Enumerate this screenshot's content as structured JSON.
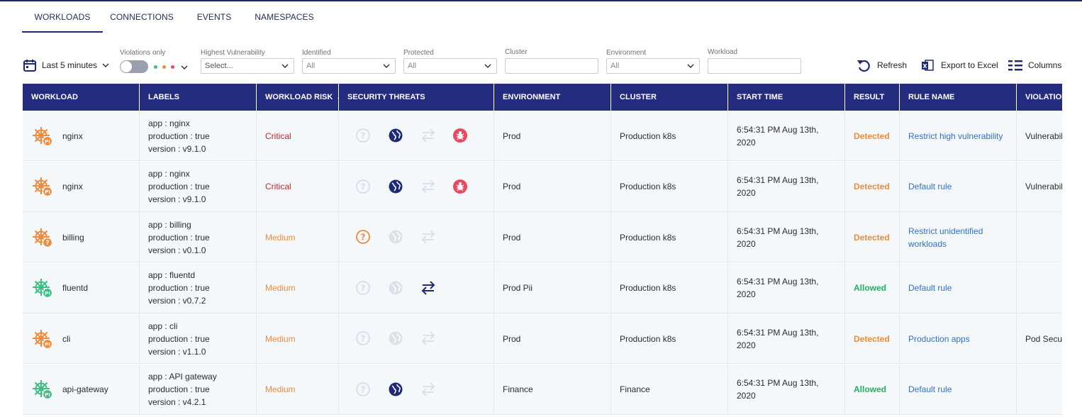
{
  "tabs": [
    "WORKLOADS",
    "CONNECTIONS",
    "EVENTS",
    "NAMESPACES"
  ],
  "filters": {
    "time": "Last 5 minutes",
    "violations_label": "Violations only",
    "vuln_label": "Highest Vulnerability",
    "vuln_placeholder": "Select...",
    "identified_label": "Identified",
    "identified_value": "All",
    "protected_label": "Protected",
    "protected_value": "All",
    "cluster_label": "Cluster",
    "environment_label": "Environment",
    "environment_value": "All",
    "workload_label": "Workload"
  },
  "actions": {
    "refresh": "Refresh",
    "export": "Export to Excel",
    "columns": "Columns"
  },
  "columns": [
    "WORKLOAD",
    "LABELS",
    "WORKLOAD RISK",
    "SECURITY THREATS",
    "ENVIRONMENT",
    "CLUSTER",
    "START TIME",
    "RESULT",
    "RULE NAME",
    "VIOLATION TYPE"
  ],
  "colors": {
    "header": "#232c7e",
    "accent": "#1e2a78",
    "orange": "#f08a3c",
    "green": "#3dbf83",
    "red": "#e84a5f",
    "link": "#2f6fce"
  },
  "rows": [
    {
      "name": "nginx",
      "icon": "helm-orange",
      "badge": "PI",
      "labels": [
        "app : nginx",
        "production : true",
        "version : v9.1.0"
      ],
      "risk": "Critical",
      "threats": {
        "unidentified": false,
        "network": true,
        "lateral": false,
        "malware": true
      },
      "environment": "Prod",
      "cluster": "Production k8s",
      "start_time_1": "6:54:31 PM Aug 13th,",
      "start_time_2": "2020",
      "result": "Detected",
      "rule": "Restrict high vulnerability",
      "violation": "Vulnerability"
    },
    {
      "name": "nginx",
      "icon": "helm-orange",
      "badge": "PI",
      "labels": [
        "app : nginx",
        "production : true",
        "version : v9.1.0"
      ],
      "risk": "Critical",
      "threats": {
        "unidentified": false,
        "network": true,
        "lateral": false,
        "malware": true
      },
      "environment": "Prod",
      "cluster": "Production k8s",
      "start_time_1": "6:54:31 PM Aug 13th,",
      "start_time_2": "2020",
      "result": "Detected",
      "rule": "Default rule",
      "violation": "Vulnerability"
    },
    {
      "name": "billing",
      "icon": "helm-orange",
      "badge": "?",
      "labels": [
        "app : billing",
        "production : true",
        "version : v0.1.0"
      ],
      "risk": "Medium",
      "threats": {
        "unidentified": true,
        "network": false,
        "lateral": false,
        "malware": null
      },
      "environment": "Prod",
      "cluster": "Production k8s",
      "start_time_1": "6:54:31 PM Aug 13th,",
      "start_time_2": "2020",
      "result": "Detected",
      "rule": "Restrict unidentified workloads",
      "violation": ""
    },
    {
      "name": "fluentd",
      "icon": "helm-green",
      "badge": "PI",
      "labels": [
        "app : fluentd",
        "production : true",
        "version : v0.7.2"
      ],
      "risk": "Medium",
      "threats": {
        "unidentified": false,
        "network": false,
        "lateral": true,
        "malware": null
      },
      "environment": "Prod Pii",
      "cluster": "Production k8s",
      "start_time_1": "6:54:31 PM Aug 13th,",
      "start_time_2": "2020",
      "result": "Allowed",
      "rule": "Default rule",
      "violation": ""
    },
    {
      "name": "cli",
      "icon": "helm-orange",
      "badge": "PI",
      "labels": [
        "app : cli",
        "production : true",
        "version : v1.1.0"
      ],
      "risk": "Medium",
      "threats": {
        "unidentified": false,
        "network": false,
        "lateral": false,
        "malware": null
      },
      "environment": "Prod",
      "cluster": "Production k8s",
      "start_time_1": "6:54:31 PM Aug 13th,",
      "start_time_2": "2020",
      "result": "Detected",
      "rule": "Production apps",
      "violation": "Pod Security"
    },
    {
      "name": "api-gateway",
      "icon": "helm-green",
      "badge": "PI",
      "labels": [
        "app : API gateway",
        "production : true",
        "version : v4.2.1"
      ],
      "risk": "Medium",
      "threats": {
        "unidentified": false,
        "network": true,
        "lateral": false,
        "malware": null
      },
      "environment": "Finance",
      "cluster": "Finance",
      "start_time_1": "6:54:31 PM Aug 13th,",
      "start_time_2": "2020",
      "result": "Allowed",
      "rule": "Default rule",
      "violation": ""
    }
  ]
}
